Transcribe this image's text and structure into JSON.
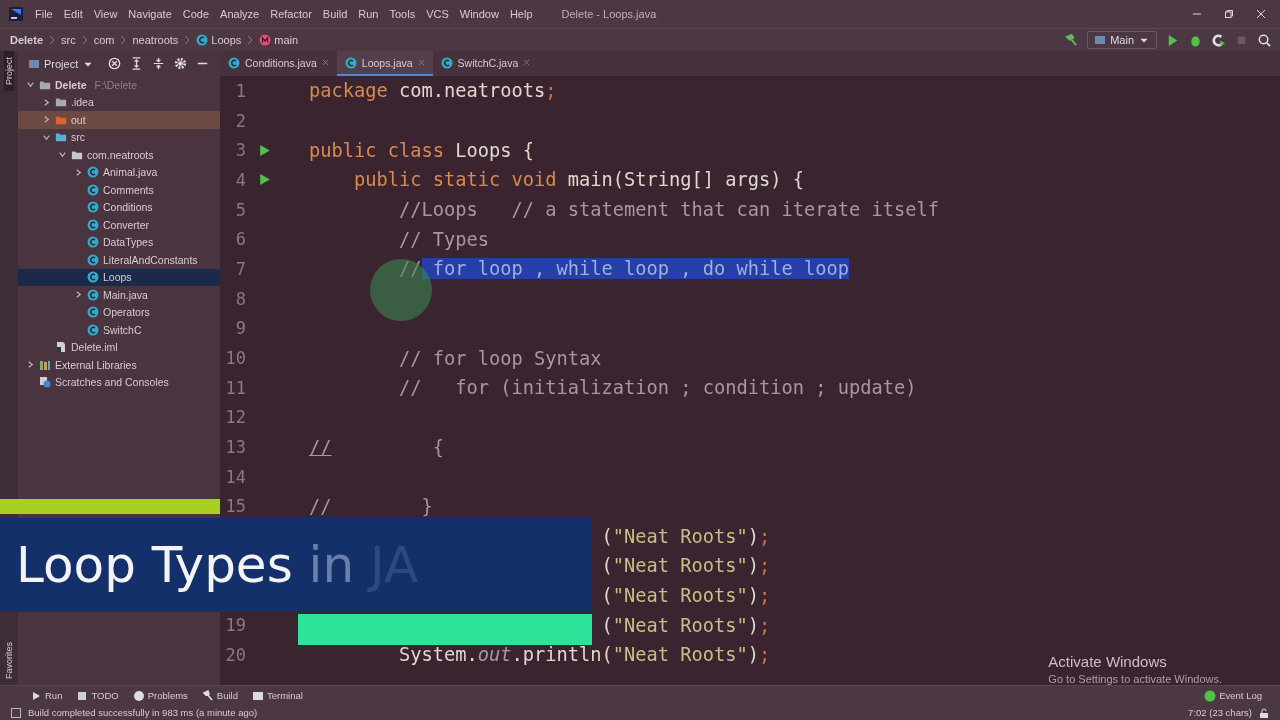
{
  "window": {
    "title": "Delete - Loops.java"
  },
  "menu": [
    "File",
    "Edit",
    "View",
    "Navigate",
    "Code",
    "Analyze",
    "Refactor",
    "Build",
    "Run",
    "Tools",
    "VCS",
    "Window",
    "Help"
  ],
  "breadcrumb": [
    {
      "label": "Delete",
      "kind": "project"
    },
    {
      "label": "src",
      "kind": "dir"
    },
    {
      "label": "com",
      "kind": "dir"
    },
    {
      "label": "neatroots",
      "kind": "dir"
    },
    {
      "label": "Loops",
      "kind": "class"
    },
    {
      "label": "main",
      "kind": "method"
    }
  ],
  "run_config": "Main",
  "left_stripe": {
    "top": "Project",
    "bottom": "Favorites"
  },
  "project_panel": {
    "title": "Project",
    "tree": [
      {
        "label": "Delete",
        "path": "F:\\Delete",
        "kind": "project",
        "expanded": true,
        "selected": false,
        "children": [
          {
            "label": ".idea",
            "kind": "folder",
            "expanded": false,
            "selected": false
          },
          {
            "label": "out",
            "kind": "excluded",
            "expanded": false,
            "selected": false
          },
          {
            "label": "src",
            "kind": "source",
            "expanded": true,
            "selected": false,
            "children": [
              {
                "label": "com.neatroots",
                "kind": "package",
                "expanded": true,
                "selected": false,
                "children": [
                  {
                    "label": "Animal.java",
                    "kind": "class",
                    "expanded": false,
                    "selected": false
                  },
                  {
                    "label": "Comments",
                    "kind": "class",
                    "selected": false
                  },
                  {
                    "label": "Conditions",
                    "kind": "class",
                    "selected": false
                  },
                  {
                    "label": "Converter",
                    "kind": "class",
                    "selected": false
                  },
                  {
                    "label": "DataTypes",
                    "kind": "class",
                    "selected": false
                  },
                  {
                    "label": "LiteralAndConstants",
                    "kind": "class",
                    "selected": false
                  },
                  {
                    "label": "Loops",
                    "kind": "class",
                    "selected": true
                  },
                  {
                    "label": "Main.java",
                    "kind": "class",
                    "expanded": false,
                    "selected": false
                  },
                  {
                    "label": "Operators",
                    "kind": "class",
                    "selected": false
                  },
                  {
                    "label": "SwitchC",
                    "kind": "class",
                    "selected": false
                  }
                ]
              }
            ]
          },
          {
            "label": "Delete.iml",
            "kind": "file",
            "selected": false
          }
        ]
      },
      {
        "label": "External Libraries",
        "kind": "libraries",
        "expanded": false,
        "selected": false
      },
      {
        "label": "Scratches and Consoles",
        "kind": "scratches",
        "selected": false
      }
    ]
  },
  "tabs": [
    {
      "label": "Conditions.java",
      "selected": false
    },
    {
      "label": "Loops.java",
      "selected": true
    },
    {
      "label": "SwitchC.java",
      "selected": false
    }
  ],
  "code": [
    {
      "number": "1",
      "tokens": [
        {
          "kind": "kw",
          "text": "package"
        },
        {
          "kind": "plain",
          "text": " com.neatroots"
        },
        {
          "kind": "semi",
          "text": ";"
        }
      ]
    },
    {
      "number": "2"
    },
    {
      "number": "3",
      "run": true,
      "tokens": [
        {
          "kind": "kw",
          "text": "public class "
        },
        {
          "kind": "plain",
          "text": "Loops {"
        }
      ]
    },
    {
      "number": "4",
      "run": true,
      "tokens": [
        {
          "kind": "kw",
          "text": "    public static void "
        },
        {
          "kind": "plain",
          "text": "main(String[] args) {"
        }
      ]
    },
    {
      "number": "5",
      "tokens": [
        {
          "kind": "comment",
          "text": "        //Loops   // a statement that can iterate itself"
        }
      ]
    },
    {
      "number": "6",
      "tokens": [
        {
          "kind": "comment",
          "text": "        // Types"
        }
      ]
    },
    {
      "number": "7",
      "tokens": [
        {
          "kind": "comment",
          "text": "        //"
        },
        {
          "kind": "selection",
          "text": " for loop , while loop , do while loop"
        }
      ]
    },
    {
      "number": "8"
    },
    {
      "number": "9"
    },
    {
      "number": "10",
      "tokens": [
        {
          "kind": "comment",
          "text": "        // for loop Syntax"
        }
      ]
    },
    {
      "number": "11",
      "tokens": [
        {
          "kind": "comment",
          "text": "        //   for (initialization ; condition ; update)"
        }
      ]
    },
    {
      "number": "12"
    },
    {
      "number": "13",
      "tokens": [
        {
          "kind": "warn",
          "text": "//"
        },
        {
          "kind": "comment",
          "text": "         {"
        }
      ]
    },
    {
      "number": "14"
    },
    {
      "number": "15",
      "tokens": [
        {
          "kind": "comment",
          "text": "//        }"
        }
      ]
    },
    {
      "covered": true,
      "tokens": [
        {
          "kind": "plain",
          "text": "("
        },
        {
          "kind": "string",
          "text": "\"Neat Roots\""
        },
        {
          "kind": "plain",
          "text": ")"
        },
        {
          "kind": "semi",
          "text": ";"
        }
      ]
    },
    {
      "covered": true,
      "tokens": [
        {
          "kind": "plain",
          "text": "("
        },
        {
          "kind": "string",
          "text": "\"Neat Roots\""
        },
        {
          "kind": "plain",
          "text": ")"
        },
        {
          "kind": "semi",
          "text": ";"
        }
      ]
    },
    {
      "covered": true,
      "tokens": [
        {
          "kind": "plain",
          "text": "("
        },
        {
          "kind": "string",
          "text": "\"Neat Roots\""
        },
        {
          "kind": "plain",
          "text": ")"
        },
        {
          "kind": "semi",
          "text": ";"
        }
      ]
    },
    {
      "number": "19",
      "covered": true,
      "tokens": [
        {
          "kind": "plain",
          "text": "("
        },
        {
          "kind": "string",
          "text": "\"Neat Roots\""
        },
        {
          "kind": "plain",
          "text": ")"
        },
        {
          "kind": "semi",
          "text": ";"
        }
      ]
    },
    {
      "number": "20",
      "tokens": [
        {
          "kind": "plain",
          "text": "        System."
        },
        {
          "kind": "field",
          "text": "out"
        },
        {
          "kind": "plain",
          "text": ".println("
        },
        {
          "kind": "string",
          "text": "\"Neat Roots\""
        },
        {
          "kind": "plain",
          "text": ")"
        },
        {
          "kind": "semi",
          "text": ";"
        }
      ]
    }
  ],
  "video_title": [
    {
      "text": "Loop Types",
      "kind": "bright"
    },
    {
      "text": "in",
      "kind": "dim"
    },
    {
      "text": "JA",
      "kind": "faint"
    }
  ],
  "activation_notice": {
    "title": "Activate Windows",
    "message": "Go to Settings to activate Windows."
  },
  "tool_tabs": [
    {
      "label": "Run",
      "kind": "run"
    },
    {
      "label": "TODO",
      "kind": "todo"
    },
    {
      "label": "Problems",
      "kind": "problems"
    },
    {
      "label": "Build",
      "kind": "build"
    },
    {
      "label": "Terminal",
      "kind": "terminal"
    }
  ],
  "event_log": "Event Log",
  "status_bar": {
    "message": "Build completed successfully in 983 ms (a minute ago)",
    "position": "7:02 (23 chars)"
  }
}
